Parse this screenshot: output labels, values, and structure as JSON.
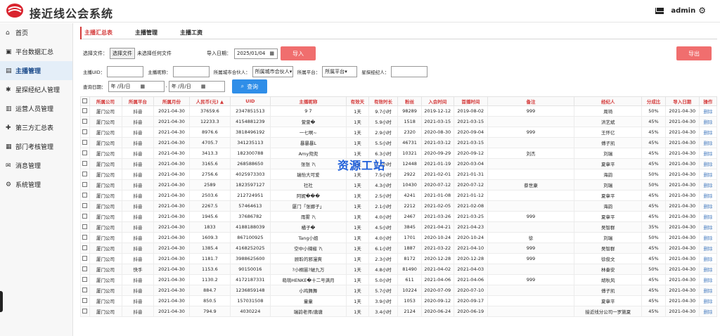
{
  "app": {
    "title": "接近线公会系统",
    "user": "admin"
  },
  "sidebar": {
    "items": [
      {
        "label": "首页",
        "icon": "⌂"
      },
      {
        "label": "平台数据汇总",
        "icon": "▣"
      },
      {
        "label": "主播管理",
        "icon": "▤",
        "active": true
      },
      {
        "label": "星探经纪人管理",
        "icon": "✱"
      },
      {
        "label": "运营人员管理",
        "icon": "▥"
      },
      {
        "label": "第三方汇总表",
        "icon": "✚"
      },
      {
        "label": "部门考核管理",
        "icon": "▦"
      },
      {
        "label": "消息管理",
        "icon": "✉"
      },
      {
        "label": "系统管理",
        "icon": "⚙"
      }
    ]
  },
  "tabs": [
    "主播汇总表",
    "主播管理",
    "主播工资"
  ],
  "toolbar": {
    "file_label": "选择文件：",
    "file_button": "选择文件",
    "file_status": "未选择任何文件",
    "import_date_label": "导入日期：",
    "import_date_value": "2025/01/04",
    "import_button": "导入",
    "export_button": "导出"
  },
  "filters": {
    "uid_label": "主播UID：",
    "nick_label": "主播昵称：",
    "city_label": "所属城市合伙人：",
    "city_value": "所属城市合伙人",
    "platform_label": "所属平台：",
    "platform_value": "所属平台",
    "agent_label": "星探经纪人：",
    "date_label": "查询日期：",
    "date_from": "年 /月/日",
    "date_sep": "-",
    "date_to": "年 /月/日",
    "search_button": "查询"
  },
  "watermark": "资源工站",
  "table": {
    "columns": [
      "",
      "所属公司",
      "所属平台",
      "所属月份",
      "人民币(元) ▲",
      "UID",
      "主播昵称",
      "有效天",
      "有效时长",
      "粉丝",
      "入会时间",
      "首播时间",
      "备注",
      "经纪人",
      "分成比",
      "导入日期",
      "操作"
    ],
    "rows": [
      [
        "厦门公司",
        "抖音",
        "2021-04-30",
        "37659.6",
        "2347851513",
        "9 7",
        "1天",
        "9.7小时",
        "98289",
        "2019-12-12",
        "2019-08-02",
        "999",
        "周琦",
        "50%",
        "2021-04-30",
        "删除"
      ],
      [
        "厦门公司",
        "抖音",
        "2021-04-30",
        "12233.3",
        "4154881239",
        "萱萱�",
        "1天",
        "5.9小时",
        "1518",
        "2021-03-15",
        "2021-03-15",
        "",
        "洪艺斌",
        "45%",
        "2021-04-30",
        "删除"
      ],
      [
        "厦门公司",
        "抖音",
        "2021-04-30",
        "8976.6",
        "3818496192",
        "一七啊~",
        "1天",
        "2.9小时",
        "2320",
        "2020-08-30",
        "2020-09-04",
        "999",
        "王怀亿",
        "45%",
        "2021-04-30",
        "删除"
      ],
      [
        "厦门公司",
        "抖音",
        "2021-04-30",
        "4705.7",
        "341235113",
        "暴暴暴L",
        "1天",
        "5.5小时",
        "46731",
        "2021-03-12",
        "2021-03-15",
        "",
        "傅子凯",
        "45%",
        "2021-04-30",
        "删除"
      ],
      [
        "厦门公司",
        "抖音",
        "2021-04-30",
        "3413.3",
        "182300788",
        "Amy兜兜",
        "1天",
        "6.3小时",
        "10321",
        "2020-09-29",
        "2020-09-12",
        "刘杰",
        "刘瑞",
        "45%",
        "2021-04-30",
        "删除"
      ],
      [
        "厦门公司",
        "抖音",
        "2021-04-30",
        "3165.6",
        "268588650",
        "张张 ?\\",
        "1天",
        "3.2小时",
        "12448",
        "2021-01-19",
        "2020-03-04",
        "",
        "夏章平",
        "45%",
        "2021-04-30",
        "删除"
      ],
      [
        "厦门公司",
        "抖音",
        "2021-04-30",
        "2756.6",
        "4025973303",
        "瑞怡大可爱",
        "1天",
        "7.5小时",
        "2922",
        "2021-02-01",
        "2021-01-31",
        "",
        "海韵",
        "50%",
        "2021-04-30",
        "删除"
      ],
      [
        "厦门公司",
        "抖音",
        "2021-04-30",
        "2589",
        "1823597127",
        "社社",
        "1天",
        "4.3小时",
        "10430",
        "2020-07-12",
        "2020-07-12",
        "蔡世康",
        "刘瑞",
        "50%",
        "2021-04-30",
        "删除"
      ],
      [
        "厦门公司",
        "抖音",
        "2021-04-30",
        "2503.6",
        "212724951",
        "阿妮���",
        "1天",
        "2.5小时",
        "4241",
        "2021-01-08",
        "2021-01-12",
        "",
        "夏章平",
        "45%",
        "2021-04-30",
        "删除"
      ],
      [
        "厦门公司",
        "抖音",
        "2021-04-30",
        "2267.5",
        "57464613",
        "厦门「张娜子」",
        "1天",
        "2.1小时",
        "2212",
        "2021-02-05",
        "2021-02-08",
        "",
        "海韵",
        "45%",
        "2021-04-30",
        "删除"
      ],
      [
        "厦门公司",
        "抖音",
        "2021-04-30",
        "1945.6",
        "37686782",
        "雨雾 ?\\",
        "1天",
        "4.0小时",
        "2467",
        "2021-03-26",
        "2021-03-25",
        "999",
        "夏章平",
        "45%",
        "2021-04-30",
        "删除"
      ],
      [
        "厦门公司",
        "抖音",
        "2021-04-30",
        "1833",
        "4188188039",
        "橘子�",
        "1天",
        "4.5小时",
        "3845",
        "2021-04-21",
        "2021-04-23",
        "",
        "吴智群",
        "35%",
        "2021-04-30",
        "删除"
      ],
      [
        "厦门公司",
        "抖音",
        "2021-04-30",
        "1609.3",
        "867100925",
        "Tang小姐",
        "1天",
        "4.0小时",
        "1701",
        "2020-10-24",
        "2020-10-24",
        "徐",
        "刘瑞",
        "50%",
        "2021-04-30",
        "删除"
      ],
      [
        "厦门公司",
        "抖音",
        "2021-04-30",
        "1385.4",
        "4168252025",
        "空中小辣椒 ?\\",
        "1天",
        "6.1小时",
        "1887",
        "2021-03-22",
        "2021-04-10",
        "999",
        "吴智群",
        "45%",
        "2021-04-30",
        "删除"
      ],
      [
        "厦门公司",
        "抖音",
        "2021-04-30",
        "1181.7",
        "3988625600",
        "顾聆的邪漫爽",
        "1天",
        "2.3小时",
        "8172",
        "2020-12-28",
        "2020-12-28",
        "999",
        "徐俊文",
        "45%",
        "2021-04-30",
        "删除"
      ],
      [
        "厦门公司",
        "快手",
        "2021-04-30",
        "1153.6",
        "90150016",
        "?小桐苗?破九万",
        "1天",
        "4.8小时",
        "81490",
        "2021-04-02",
        "2021-04-03",
        "",
        "林秦安",
        "50%",
        "2021-04-30",
        "删除"
      ],
      [
        "厦门公司",
        "抖音",
        "2021-04-30",
        "1130.2",
        "4172187331",
        "萌萌HENKE�十二号满月",
        "1天",
        "5.0小时",
        "611",
        "2021-04-06",
        "2021-04-06",
        "999",
        "胡秋风",
        "45%",
        "2021-04-30",
        "删除"
      ],
      [
        "厦门公司",
        "抖音",
        "2021-04-30",
        "884.7",
        "1236859148",
        "小鸡舞舞",
        "1天",
        "5.7小时",
        "10224",
        "2020-07-09",
        "2020-07-10",
        "",
        "傅子凯",
        "45%",
        "2021-04-30",
        "删除"
      ],
      [
        "厦门公司",
        "抖音",
        "2021-04-30",
        "850.5",
        "157031508",
        "童童",
        "1天",
        "3.9小时",
        "1053",
        "2020-09-12",
        "2020-09-17",
        "",
        "夏章平",
        "45%",
        "2021-04-30",
        "删除"
      ],
      [
        "厦门公司",
        "抖音",
        "2021-04-30",
        "794.9",
        "4030224",
        "瑞韵老师/唐唐",
        "1天",
        "3.4小时",
        "2124",
        "2020-06-24",
        "2020-06-19",
        "",
        "接近线分公司一罗施夏",
        "45%",
        "2021-04-30",
        "删除"
      ]
    ]
  }
}
